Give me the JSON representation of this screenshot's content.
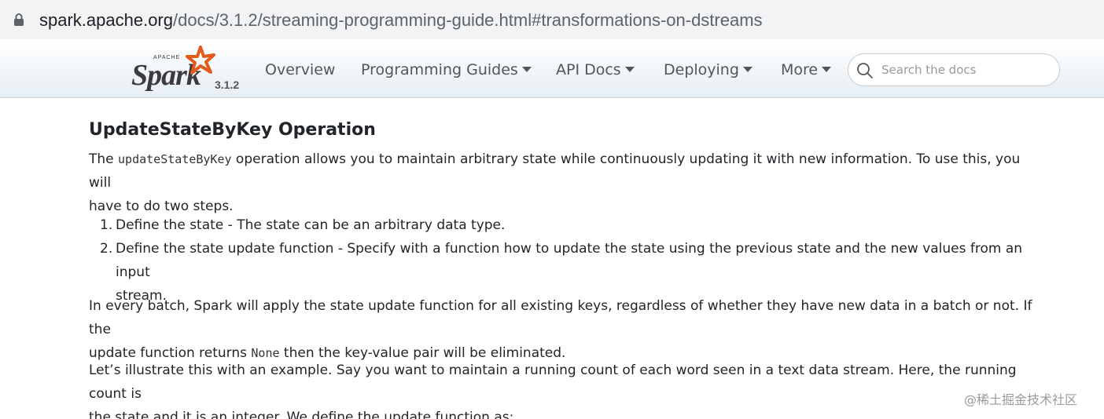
{
  "browser": {
    "url_host": "spark.apache.org",
    "url_path": "/docs/3.1.2/streaming-programming-guide.html#transformations-on-dstreams"
  },
  "navbar": {
    "brand_apache": "APACHE",
    "brand_name": "Spark",
    "version": "3.1.2",
    "items": [
      {
        "label": "Overview",
        "dropdown": false
      },
      {
        "label": "Programming Guides",
        "dropdown": true
      },
      {
        "label": "API Docs",
        "dropdown": true
      },
      {
        "label": "Deploying",
        "dropdown": true
      },
      {
        "label": "More",
        "dropdown": true
      }
    ],
    "search_placeholder": "Search the docs"
  },
  "content": {
    "heading": "UpdateStateByKey Operation",
    "intro_before": "The ",
    "intro_code": "updateStateByKey",
    "intro_after_line1": " operation allows you to maintain arbitrary state while continuously updating it with new information. To use this, you will",
    "intro_line2": "have to do two steps.",
    "steps": [
      {
        "num": "1.",
        "text": "Define the state - The state can be an arbitrary data type."
      },
      {
        "num": "2.",
        "text_line1": "Define the state update function - Specify with a function how to update the state using the previous state and the new values from an input",
        "text_line2": "stream."
      }
    ],
    "batch_line1": "In every batch, Spark will apply the state update function for all existing keys, regardless of whether they have new data in a batch or not. If the",
    "batch_line2_before": "update function returns ",
    "batch_code": "None",
    "batch_line2_after": " then the key-value pair will be eliminated.",
    "example_line1": "Let’s illustrate this with an example. Say you want to maintain a running count of each word seen in a text data stream. Here, the running count is",
    "example_line2": "the state and it is an integer. We define the update function as:"
  },
  "watermark": "@稀土掘金技术社区",
  "colors": {
    "star": "#e25a1c",
    "navbar_text": "#555555",
    "body_text": "#212529"
  }
}
